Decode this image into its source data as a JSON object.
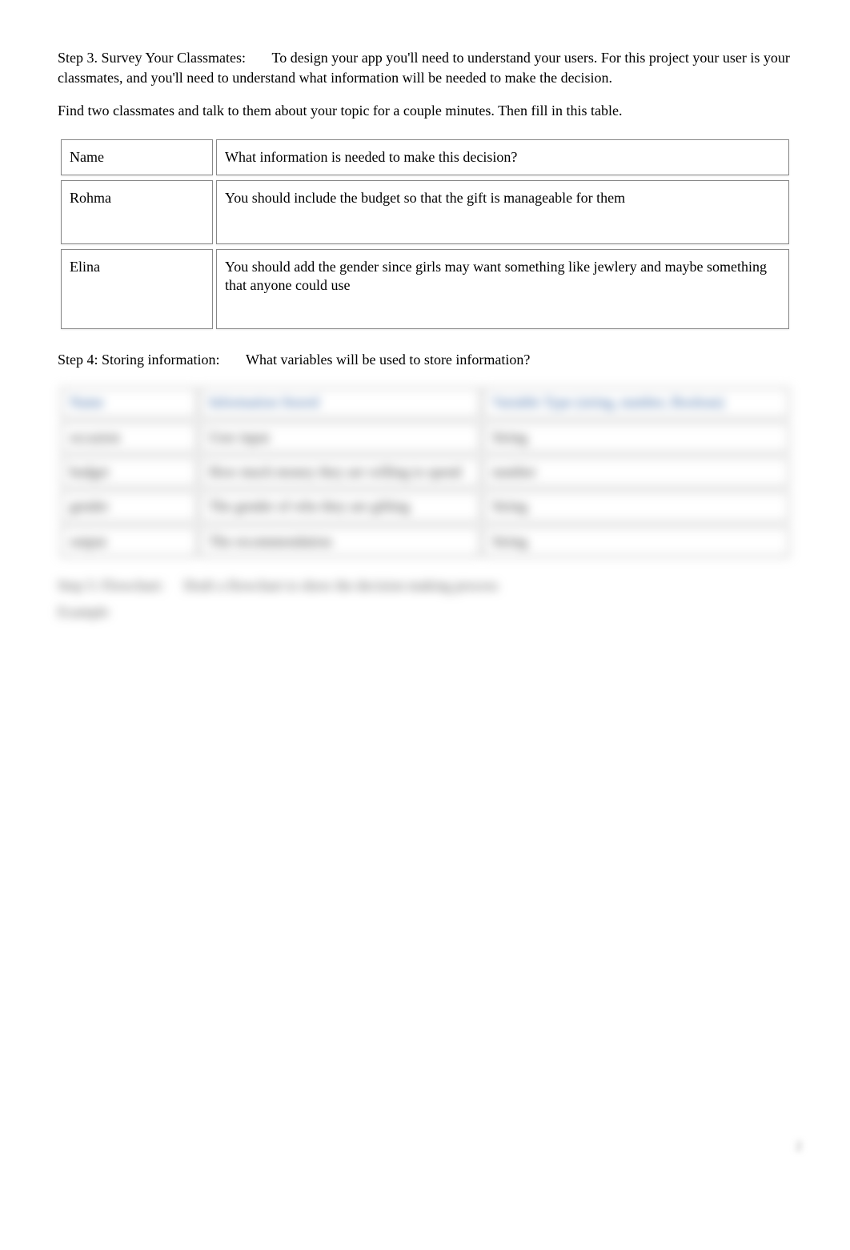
{
  "step3": {
    "label": "Step 3. Survey Your Classmates:",
    "text": "To design your app you'll need to understand your users. For this project your user is your classmates, and you'll need to understand what information will be needed to make the decision.",
    "instruction": "Find two classmates and talk to them about your topic for a couple minutes. Then fill in this table."
  },
  "table1": {
    "headers": [
      "Name",
      "What information is needed to make this decision?"
    ],
    "rows": [
      [
        "Rohma",
        "You should include the budget so that the gift is manageable for them"
      ],
      [
        "Elina",
        "You should add the gender since girls may want something like jewlery and maybe something that anyone could use"
      ]
    ]
  },
  "step4": {
    "label": "Step 4: Storing information:",
    "text": "What variables will be used to store information?"
  },
  "table2": {
    "headers": [
      "Name",
      "Information Stored",
      "Variable Type (string, number, Boolean)"
    ],
    "rows": [
      [
        "occasion",
        "User input",
        "String"
      ],
      [
        "budget",
        "How much money they are willing to spend",
        "number"
      ],
      [
        "gender",
        "The gender of who they are gifting",
        "String"
      ],
      [
        "output",
        "The recommendation",
        "String"
      ]
    ]
  },
  "step5": {
    "label": "Step 5: Flowchart:",
    "text": "Draft a flowchart to show the decision making process",
    "example": "Example"
  },
  "pageNum": "2"
}
